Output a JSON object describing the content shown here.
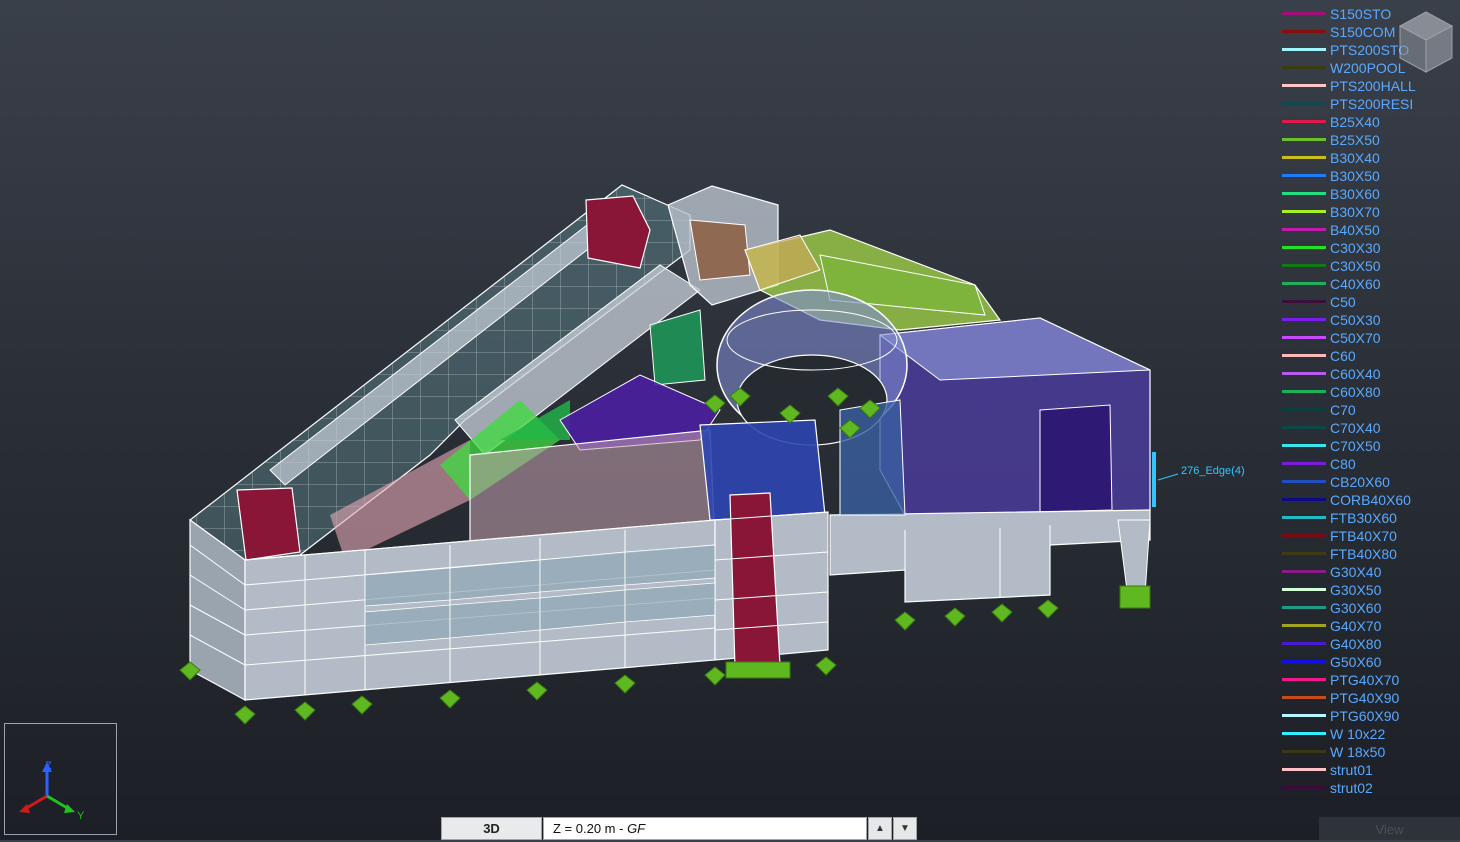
{
  "legend": {
    "items": [
      {
        "label": "S150STO",
        "color": "#a0117a"
      },
      {
        "label": "S150COM",
        "color": "#8a0e0e"
      },
      {
        "label": "PTS200STO",
        "color": "#9ff5ff"
      },
      {
        "label": "W200POOL",
        "color": "#3b3b12"
      },
      {
        "label": "PTS200HALL",
        "color": "#ffc4c4"
      },
      {
        "label": "PTS200RESI",
        "color": "#134848"
      },
      {
        "label": "B25X40",
        "color": "#e0194a"
      },
      {
        "label": "B25X50",
        "color": "#6fbf2a"
      },
      {
        "label": "B30X40",
        "color": "#c9c01b"
      },
      {
        "label": "B30X50",
        "color": "#1a7cff"
      },
      {
        "label": "B30X60",
        "color": "#22e082"
      },
      {
        "label": "B30X70",
        "color": "#a8f024"
      },
      {
        "label": "B40X50",
        "color": "#c21bb0"
      },
      {
        "label": "C30X30",
        "color": "#21e221"
      },
      {
        "label": "C30X50",
        "color": "#0f7a0f"
      },
      {
        "label": "C40X60",
        "color": "#1fae5a"
      },
      {
        "label": "C50",
        "color": "#3b0f3b"
      },
      {
        "label": "C50X30",
        "color": "#7a1bf0"
      },
      {
        "label": "C50X70",
        "color": "#c64bff"
      },
      {
        "label": "C60",
        "color": "#ffb8b8"
      },
      {
        "label": "C60X40",
        "color": "#b85af0"
      },
      {
        "label": "C60X80",
        "color": "#1ab258"
      },
      {
        "label": "C70",
        "color": "#0f3d3d"
      },
      {
        "label": "C70X40",
        "color": "#0b4848"
      },
      {
        "label": "C70X50",
        "color": "#35e6f0"
      },
      {
        "label": "C80",
        "color": "#7a1be0"
      },
      {
        "label": "CB20X60",
        "color": "#1f4fc0"
      },
      {
        "label": "CORB40X60",
        "color": "#0b0b8a"
      },
      {
        "label": "FTB30X60",
        "color": "#22b8c6"
      },
      {
        "label": "FTB40X70",
        "color": "#7a0b14"
      },
      {
        "label": "FTB40X80",
        "color": "#3e3b16"
      },
      {
        "label": "G30X40",
        "color": "#8a1a8a"
      },
      {
        "label": "G30X50",
        "color": "#d4ffd8"
      },
      {
        "label": "G30X60",
        "color": "#1c9a8a"
      },
      {
        "label": "G40X70",
        "color": "#a3a322"
      },
      {
        "label": "G40X80",
        "color": "#4a1ad0"
      },
      {
        "label": "G50X60",
        "color": "#1010e0"
      },
      {
        "label": "PTG40X70",
        "color": "#f01a8a"
      },
      {
        "label": "PTG40X90",
        "color": "#c84a1a"
      },
      {
        "label": "PTG60X90",
        "color": "#b8f6ff"
      },
      {
        "label": "W 10x22",
        "color": "#2ef0ff"
      },
      {
        "label": "W 18x50",
        "color": "#3a3812"
      },
      {
        "label": "strut01",
        "color": "#ffc0c6"
      },
      {
        "label": "strut02",
        "color": "#3a0b3a"
      }
    ]
  },
  "annotation": {
    "edge_label": "276_Edge(4)"
  },
  "axes": {
    "z": "Z",
    "y": "Y",
    "x_color": "#d21a1a",
    "y_color": "#22c022",
    "z_color": "#2a62ff"
  },
  "bottom_bar": {
    "view_mode": "3D",
    "level_value": "Z = 0.20 m - ",
    "level_name": "GF"
  },
  "view_tab": {
    "label": "View"
  },
  "colors": {
    "wire": "#ffffff",
    "wall": "#a9b2bd",
    "support": "#5fb820",
    "accent": "#35c4ff"
  }
}
